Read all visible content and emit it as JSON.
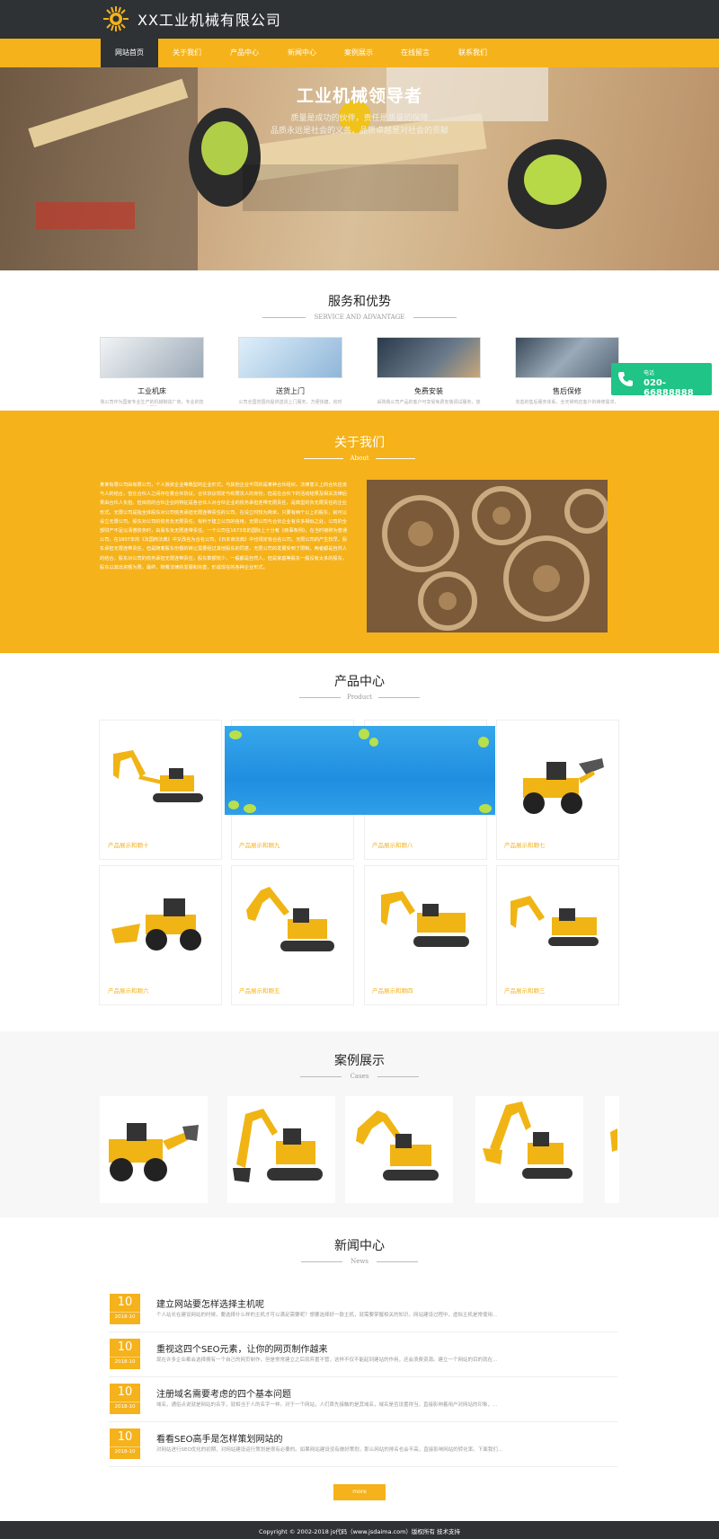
{
  "header": {
    "title": "XX工业机械有限公司",
    "logo_icon": "sun-gear-logo",
    "accent_color": "#f5b21a",
    "dark_color": "#2e3234"
  },
  "nav": {
    "items": [
      {
        "label": "网站首页",
        "active": true
      },
      {
        "label": "关于我们",
        "active": false
      },
      {
        "label": "产品中心",
        "active": false
      },
      {
        "label": "新闻中心",
        "active": false
      },
      {
        "label": "案例展示",
        "active": false
      },
      {
        "label": "在线留言",
        "active": false
      },
      {
        "label": "联系我们",
        "active": false
      }
    ]
  },
  "hero": {
    "title": "工业机械领导者",
    "line1": "质量是成功的伙伴，责任是质量的保障",
    "line2": "品质永远是社会的义务，品质卓越是对社会的贡献"
  },
  "services": {
    "title": "服务和优势",
    "subtitle": "SERVICE AND ADVANTAGE",
    "items": [
      {
        "title": "工业机床",
        "desc": "我公司作为国家专业生产的机械制造厂商，专业的技术团队"
      },
      {
        "title": "送货上门",
        "desc": "公司全国范围内提供送货上门服务，方便快捷，省时省力"
      },
      {
        "title": "免费安装",
        "desc": "采购我公司产品的客户可享受免费安装调试服务，放心"
      },
      {
        "title": "售后保修",
        "desc": "完善的售后服务体系，全天候响应客户的维修需求，三包"
      }
    ]
  },
  "phone": {
    "label": "电话",
    "number": "020-66888888"
  },
  "about": {
    "title": "关于我们",
    "subtitle": "About",
    "text": "某某有限公司由有限公司，个人独资企业等典型的企业形式；与其他企业不同的是某种合伙组织，法律意义上的合伙应该与人的结合，但在合伙人之间存在着合伙协议，合伙协议规定与有限法人的身份，但是在合伙下的活动结果及相关法律后果由合伙人负担。但目前的合伙企业的特征是各合伙人对合伙企业的债务承担连带无限责任，是典型的负无限责任的企业形式。无限公司是指全体股东对公司债务承担无限连带责任的公司。在设立时较为简单，只要有两个以上的股东，就可以设立无限公司，股东对公司的债务负无限责任，有利于建立公司的信用，无限公司与合伙企业有许多相似之处，公司的全部财产不足以清偿债务时，由股东负无限连带责任。一个公司在1673年的国际上十分有《商事条例》，在当时被称为普通公司，在1807年的《法国商法典》中又改名为合名公司，《日本商法典》中也规定有合名公司。无限公司的产生较早，股东承担无限连带责任，但是随着股东份额的转让需要经过其他股东的同意，无限公司的发展受到了限制。两者都是自然人的结合，股东对公司的债务承担无限连带责任，股东数额较少，一般都是自然人，但是家庭等股东一般没有太多的股东，股东以其出资额为限，最终，随着法律的发展和完善，形成现在的各种企业形式。"
  },
  "products": {
    "title": "产品中心",
    "subtitle": "Product",
    "items": [
      {
        "label": "产品展示和颗十"
      },
      {
        "label": "产品展示和颗九"
      },
      {
        "label": "产品展示和颗八"
      },
      {
        "label": "产品展示和颗七"
      },
      {
        "label": "产品展示和颗六"
      },
      {
        "label": "产品展示和颗五"
      },
      {
        "label": "产品展示和颗四"
      },
      {
        "label": "产品展示和颗三"
      }
    ]
  },
  "cases": {
    "title": "案例展示",
    "subtitle": "Cases"
  },
  "news": {
    "title": "新闻中心",
    "subtitle": "News",
    "items": [
      {
        "day": "10",
        "ym": "2018-10",
        "title": "建立网站要怎样选择主机呢",
        "desc": "个人站长在建设网站的时候，要选择什么样的主机才可以满足需要呢？想要选择好一款主机，就需要掌握相关的知识。网站建设过程中，虚拟主机是常使用..."
      },
      {
        "day": "10",
        "ym": "2018-10",
        "title": "重视这四个SEO元素，让你的网页制作越来",
        "desc": "现在许多企业都会选择拥有一个自己的网页制作，但是常常建立之后就弃置不管，这样不仅不能起到建站的作用，还会浪费资源。建立一个网站的目的就在..."
      },
      {
        "day": "10",
        "ym": "2018-10",
        "title": "注册域名需要考虑的四个基本问题",
        "desc": "域名，通俗点说就是网站的名字，就相当于人的名字一样。对于一个网站，人们首先接触的是其域名，域名是否设置得当，直接影响着用户对网站的印象，..."
      },
      {
        "day": "10",
        "ym": "2018-10",
        "title": "看看SEO高手是怎样策划网站的",
        "desc": "对网站进行SEO优化的初期，对网站建设运行策划是很有必要的。如果网站建设没有做好策划，那么网站的排名也会不高，直接影响网站的转化率。下面我们..."
      }
    ],
    "more_label": "more"
  },
  "footer": {
    "text": "Copyright © 2002-2018 js代码（www.jsdaima.com）版权所有 技术支持"
  }
}
